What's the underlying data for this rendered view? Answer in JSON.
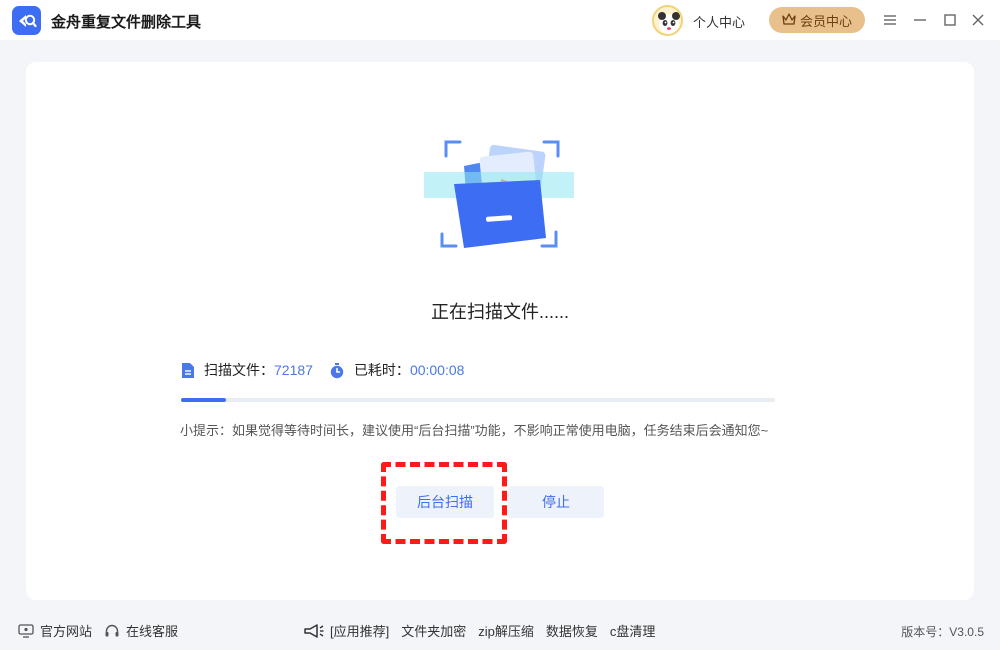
{
  "app": {
    "title": "金舟重复文件删除工具",
    "user_center_label": "个人中心",
    "vip_label": "会员中心"
  },
  "icons": {
    "logo": "app-logo-icon",
    "vip": "crown-icon",
    "menu": "menu-icon",
    "minimize": "minimize-icon",
    "maximize": "maximize-icon",
    "close": "close-icon"
  },
  "scan": {
    "status": "正在扫描文件......",
    "files_label": "扫描文件：",
    "files_value": "72187",
    "elapsed_label": "已耗时：",
    "elapsed_value": "00:00:08",
    "progress": 0.076,
    "tip": "小提示：如果觉得等待时间长，建议使用“后台扫描”功能，不影响正常使用电脑，任务结束后会通知您~",
    "background_btn": "后台扫描",
    "stop_btn": "停止"
  },
  "footer": {
    "website": "官方网站",
    "support": "在线客服",
    "recommend": "[应用推荐]",
    "links": [
      "文件夹加密",
      "zip解压缩",
      "数据恢复",
      "c盘清理"
    ],
    "version": "版本号：V3.0.5"
  },
  "colors": {
    "accent": "#3d6df2",
    "vip_bg": "#e8c08c",
    "highlight": "#ff1a1a"
  }
}
